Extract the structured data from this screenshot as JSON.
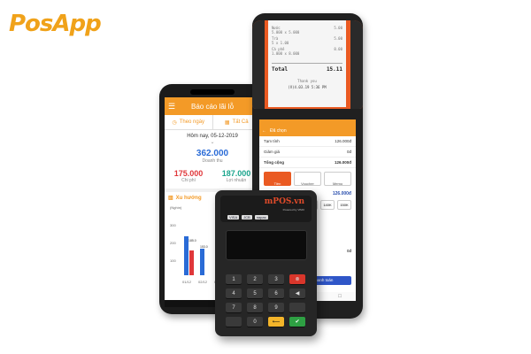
{
  "logo": "PosApp",
  "phone": {
    "title": "Báo cáo lãi lỗ",
    "tab_left": "Theo ngày",
    "tab_right": "Tất Cả",
    "date": "Hôm nay, 05-12-2019",
    "revenue_value": "362.000",
    "revenue_label": "Doanh thu",
    "cost_value": "175.000",
    "cost_label": "Chi phí",
    "profit_value": "187.000",
    "profit_label": "Lợi nhuận",
    "trend_title": "Xu hướng",
    "unit": "(Nghìn)",
    "y_ticks": [
      "300",
      "200",
      "100"
    ],
    "bar_labels": [
      "185.0",
      "153.0"
    ],
    "x_labels": [
      "01/12",
      "02/12",
      "03/12"
    ],
    "colors": {
      "revenue": "#2a6bd6",
      "cost": "#e0373a",
      "profit": "#1aa58d",
      "accent": "#f39a27"
    }
  },
  "pos": {
    "receipt": {
      "lines": [
        {
          "name": "Nước",
          "qty": "5.000 x 5.000",
          "amount": "5.00"
        },
        {
          "name": "Trà",
          "qty": "5 x 1.00",
          "amount": "5.00"
        },
        {
          "name": "Cà phê",
          "qty": "1.000 x 8.000",
          "amount": "8.00"
        }
      ],
      "total_label": "Total",
      "total_value": "15.11",
      "thanks": "Thank you",
      "footer": "(V)4.03.19 5:36 PM"
    },
    "screen": {
      "header": "Đã chọn",
      "subtotal_label": "Tạm tính",
      "subtotal_value": "126.000đ",
      "discount_label": "Giảm giá",
      "discount_value": "0đ",
      "total_label": "Tổng cộng",
      "total_value": "126.000đ",
      "methods": [
        "Tiền",
        "Voucher",
        "Memo"
      ],
      "due_value": "126.000đ",
      "quick": [
        "100K",
        "140K",
        "150K"
      ],
      "change_value": "0đ",
      "pay_button": "Thanh toán"
    }
  },
  "reader": {
    "brand": "mPOS.vn",
    "powered": "Powered by VIMO",
    "cards": [
      "VISA",
      "JCB",
      "napas"
    ],
    "keys": [
      "1",
      "2",
      "3",
      "⊗",
      "4",
      "5",
      "6",
      "◀",
      "7",
      "8",
      "9",
      "",
      "",
      "0",
      "⟵",
      "✔"
    ]
  }
}
